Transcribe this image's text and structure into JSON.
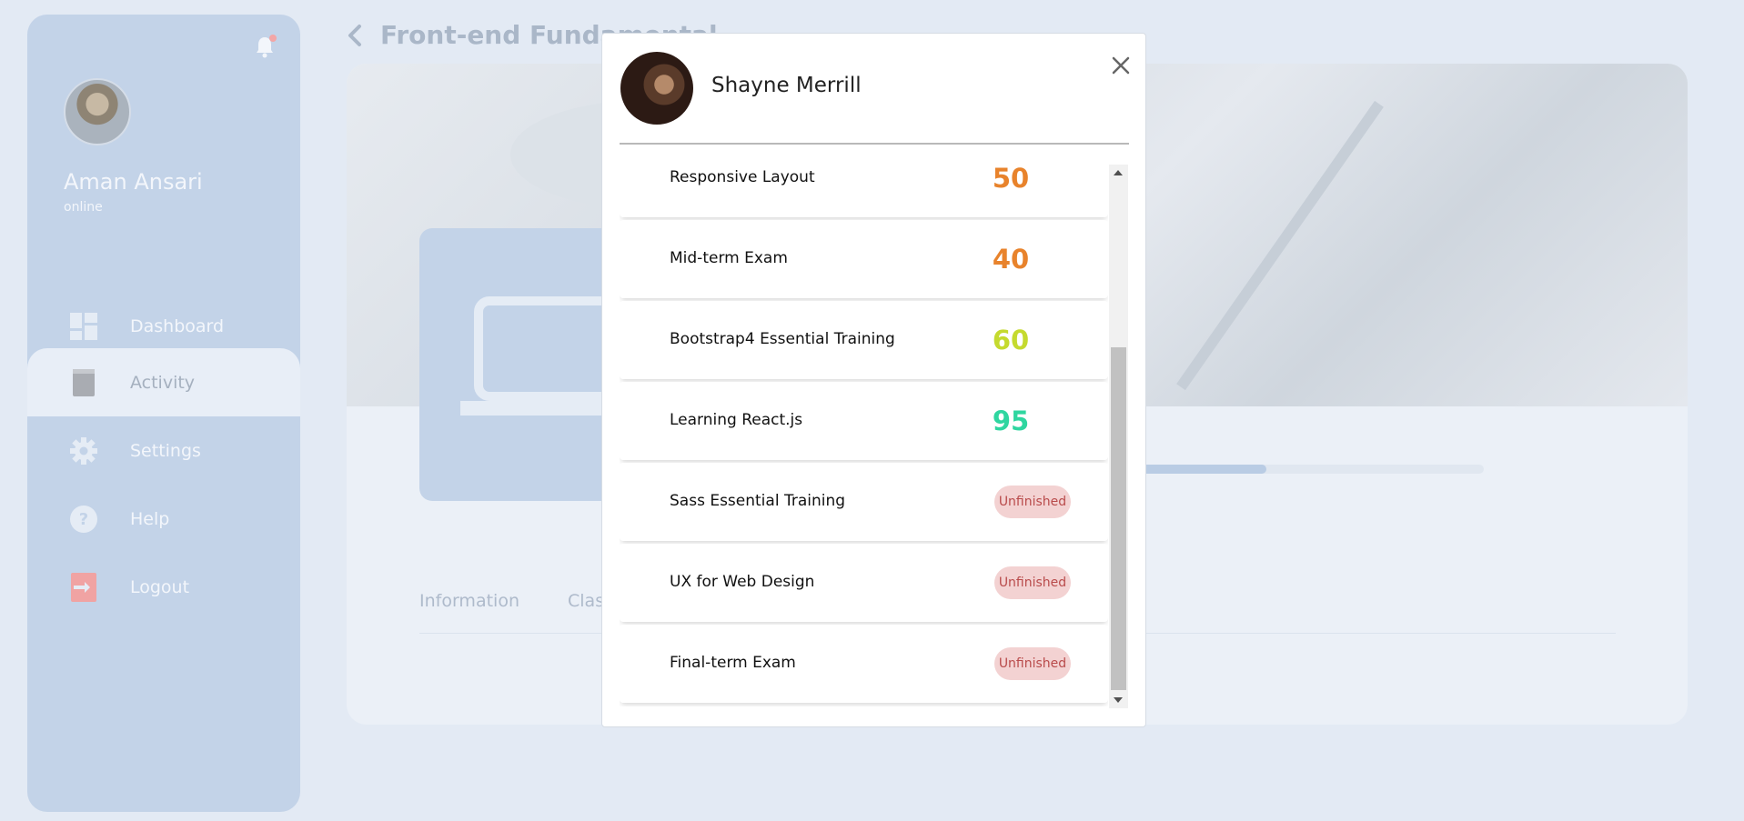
{
  "sidebar": {
    "user": {
      "name": "Aman Ansari",
      "status": "online"
    },
    "nav": [
      {
        "label": "Dashboard",
        "icon": "dashboard-icon"
      },
      {
        "label": "Activity",
        "icon": "book-icon",
        "active": true
      },
      {
        "label": "Settings",
        "icon": "gear-icon"
      },
      {
        "label": "Help",
        "icon": "help-icon"
      },
      {
        "label": "Logout",
        "icon": "logout-icon"
      }
    ]
  },
  "main": {
    "title": "Front-end Fundamental",
    "progress": 0.37,
    "tabs": [
      {
        "label": "Information"
      },
      {
        "label": "Clas"
      }
    ]
  },
  "modal": {
    "student_name": "Shayne Merrill",
    "items": [
      {
        "title": "Responsive Layout",
        "score": "50",
        "color": "#e8832c"
      },
      {
        "title": "Mid-term Exam",
        "score": "40",
        "color": "#e8832c"
      },
      {
        "title": "Bootstrap4 Essential Training",
        "score": "60",
        "color": "#c5da2f"
      },
      {
        "title": "Learning React.js",
        "score": "95",
        "color": "#2fd6a0"
      },
      {
        "title": "Sass Essential Training",
        "badge": "Unfinished"
      },
      {
        "title": "UX for Web Design",
        "badge": "Unfinished"
      },
      {
        "title": "Final-term Exam",
        "badge": "Unfinished"
      }
    ]
  },
  "colors": {
    "sidebar_bg": "#c3d3e8",
    "page_bg": "#e3eaf4",
    "badge_bg": "#f3d2d2",
    "badge_text": "#b94b4b"
  }
}
